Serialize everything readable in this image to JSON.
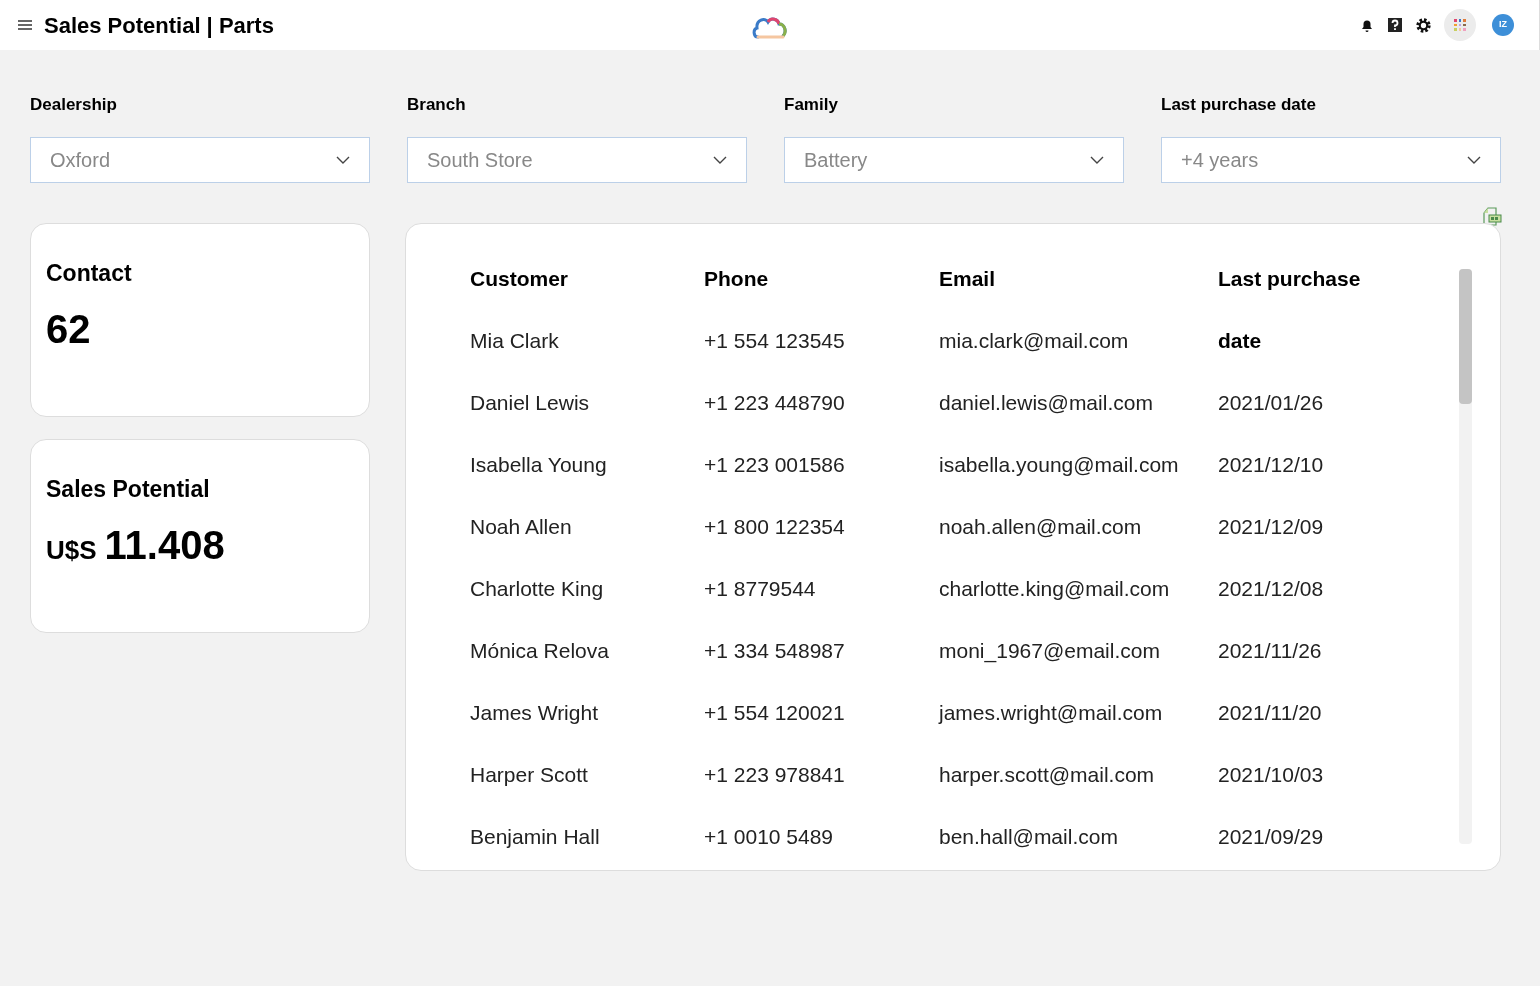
{
  "header": {
    "title": "Sales Potential | Parts",
    "avatar": "IZ"
  },
  "filters": [
    {
      "label": "Dealership",
      "value": "Oxford"
    },
    {
      "label": "Branch",
      "value": "South Store"
    },
    {
      "label": "Family",
      "value": "Battery"
    },
    {
      "label": "Last purchase date",
      "value": "+4 years"
    }
  ],
  "kpis": [
    {
      "label": "Contact",
      "value": "62"
    },
    {
      "label": "Sales Potential",
      "currency": "U$S",
      "value": "11.408"
    }
  ],
  "table": {
    "columns": [
      {
        "header": "Customer",
        "values": [
          "Mia Clark",
          "Daniel Lewis",
          "Isabella Young",
          "Noah Allen",
          "Charlotte King",
          "Mónica Relova",
          "James Wright",
          "Harper Scott",
          "Benjamin Hall"
        ]
      },
      {
        "header": "Phone",
        "values": [
          "+1 554 123545",
          "+1 223 448790",
          "+1 223 001586",
          "+1 800 122354",
          "+1 8779544",
          "+1 334 548987",
          "+1 554 120021",
          "+1 223 978841",
          "+1 0010 5489"
        ]
      },
      {
        "header": "Email",
        "values": [
          "mia.clark@mail.com",
          "daniel.lewis@mail.com",
          "isabella.young@mail.com",
          "noah.allen@mail.com",
          "charlotte.king@mail.com",
          "moni_1967@email.com",
          "james.wright@mail.com",
          "harper.scott@mail.com",
          "ben.hall@mail.com"
        ]
      },
      {
        "header": "Last purchase date",
        "values": [
          "2021/01/26",
          "2021/12/10",
          "2021/12/09",
          "2021/12/08",
          "2021/11/26",
          "2021/11/20",
          "2021/10/03",
          "2021/09/29"
        ]
      }
    ]
  }
}
